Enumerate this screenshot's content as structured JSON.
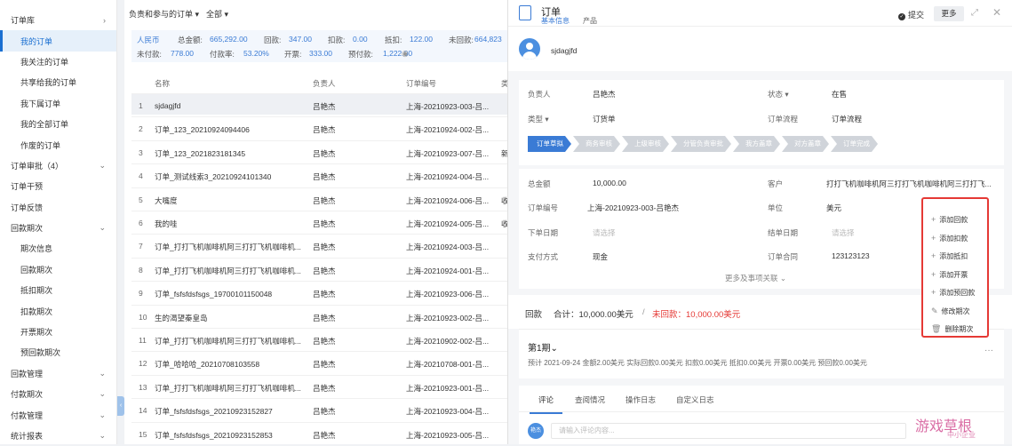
{
  "sidebar": {
    "items": [
      {
        "label": "订单库",
        "chev": "›",
        "child": false,
        "active": false
      },
      {
        "label": "我的订单",
        "chev": "",
        "child": true,
        "active": true
      },
      {
        "label": "我关注的订单",
        "chev": "",
        "child": true,
        "active": false
      },
      {
        "label": "共享给我的订单",
        "chev": "",
        "child": true,
        "active": false
      },
      {
        "label": "我下属订单",
        "chev": "",
        "child": true,
        "active": false
      },
      {
        "label": "我的全部订单",
        "chev": "",
        "child": true,
        "active": false
      },
      {
        "label": "作废的订单",
        "chev": "",
        "child": true,
        "active": false
      },
      {
        "label": "订单审批（4）",
        "chev": "⌄",
        "child": false,
        "active": false
      },
      {
        "label": "订单干预",
        "chev": "",
        "child": false,
        "active": false
      },
      {
        "label": "订单反馈",
        "chev": "",
        "child": false,
        "active": false
      },
      {
        "label": "回款期次",
        "chev": "⌄",
        "child": false,
        "active": false
      },
      {
        "label": "期次信息",
        "chev": "",
        "child": true,
        "active": false
      },
      {
        "label": "回款期次",
        "chev": "",
        "child": true,
        "active": false
      },
      {
        "label": "抵扣期次",
        "chev": "",
        "child": true,
        "active": false
      },
      {
        "label": "扣款期次",
        "chev": "",
        "child": true,
        "active": false
      },
      {
        "label": "开票期次",
        "chev": "",
        "child": true,
        "active": false
      },
      {
        "label": "预回款期次",
        "chev": "",
        "child": true,
        "active": false
      },
      {
        "label": "回款管理",
        "chev": "⌄",
        "child": false,
        "active": false
      },
      {
        "label": "付款期次",
        "chev": "⌄",
        "child": false,
        "active": false
      },
      {
        "label": "付款管理",
        "chev": "⌄",
        "child": false,
        "active": false
      },
      {
        "label": "统计报表",
        "chev": "⌄",
        "child": false,
        "active": false
      }
    ],
    "collapse": "‹"
  },
  "list": {
    "filter": "负责和参与的订单 ▾",
    "scope": "全部 ▾",
    "summary": {
      "currency": "人民币",
      "total_label": "总金额:",
      "total": "665,292.00",
      "back_label": "回款:",
      "back": "347.00",
      "deduct_label": "扣款:",
      "deduct": "0.00",
      "offset_label": "抵扣:",
      "offset": "122.00",
      "unback_label": "未回款:",
      "unback": "664,823",
      "unpaid_label": "未付款:",
      "unpaid": "778.00",
      "payrate_label": "付款率:",
      "payrate": "53.20%",
      "invoice_label": "开票:",
      "invoice": "333.00",
      "prepay_label": "预付款:",
      "prepay": "1,222.00"
    },
    "columns": {
      "name": "名称",
      "owner": "负责人",
      "code": "订单编号",
      "extra": "类"
    },
    "rows": [
      {
        "no": "1",
        "name": "sjdagjfd",
        "owner": "吕艳杰",
        "code": "上海-20210923-003-吕...",
        "extra": ""
      },
      {
        "no": "2",
        "name": "订单_123_20210924094406",
        "owner": "吕艳杰",
        "code": "上海-20210924-002-吕...",
        "extra": ""
      },
      {
        "no": "3",
        "name": "订单_123_2021823181345",
        "owner": "吕艳杰",
        "code": "上海-20210923-007-吕...",
        "extra": "新"
      },
      {
        "no": "4",
        "name": "订单_测试线索3_20210924101340",
        "owner": "吕艳杰",
        "code": "上海-20210924-004-吕...",
        "extra": ""
      },
      {
        "no": "5",
        "name": "大嘴度",
        "owner": "吕艳杰",
        "code": "上海-20210924-006-吕...",
        "extra": "收"
      },
      {
        "no": "6",
        "name": "我的哇",
        "owner": "吕艳杰",
        "code": "上海-20210924-005-吕...",
        "extra": "收"
      },
      {
        "no": "7",
        "name": "订单_打打飞机咖啡机阿三打打飞机咖啡机...",
        "owner": "吕艳杰",
        "code": "上海-20210924-003-吕...",
        "extra": ""
      },
      {
        "no": "8",
        "name": "订单_打打飞机咖啡机阿三打打飞机咖啡机...",
        "owner": "吕艳杰",
        "code": "上海-20210924-001-吕...",
        "extra": ""
      },
      {
        "no": "9",
        "name": "订单_fsfsfdsfsgs_19700101150048",
        "owner": "吕艳杰",
        "code": "上海-20210923-006-吕...",
        "extra": ""
      },
      {
        "no": "10",
        "name": "生的渴望秦皇岛",
        "owner": "吕艳杰",
        "code": "上海-20210923-002-吕...",
        "extra": ""
      },
      {
        "no": "11",
        "name": "订单_打打飞机咖啡机阿三打打飞机咖啡机...",
        "owner": "吕艳杰",
        "code": "上海-20210902-002-吕...",
        "extra": ""
      },
      {
        "no": "12",
        "name": "订单_哈哈哈_20210708103558",
        "owner": "吕艳杰",
        "code": "上海-20210708-001-吕...",
        "extra": ""
      },
      {
        "no": "13",
        "name": "订单_打打飞机咖啡机阿三打打飞机咖啡机...",
        "owner": "吕艳杰",
        "code": "上海-20210923-001-吕...",
        "extra": ""
      },
      {
        "no": "14",
        "name": "订单_fsfsfdsfsgs_20210923152827",
        "owner": "吕艳杰",
        "code": "上海-20210923-004-吕...",
        "extra": ""
      },
      {
        "no": "15",
        "name": "订单_fsfsfdsfsgs_20210923152853",
        "owner": "吕艳杰",
        "code": "上海-20210923-005-吕...",
        "extra": ""
      }
    ]
  },
  "detail": {
    "title": "订单",
    "tab_basic": "基本信息",
    "tab_product": "产品",
    "submit": "提交",
    "more": "更多",
    "expand": "⤢",
    "close": "✕",
    "user": "sjdagjfd",
    "owner_label": "负责人",
    "owner": "吕艳杰",
    "status_label": "状态 ▾",
    "status": "在售",
    "type_label": "类型 ▾",
    "type": "订货单",
    "flow_label": "订单流程",
    "flow": "订单流程",
    "steps": [
      "订单草拟",
      "商务审核",
      "上级审核",
      "分管负责审批",
      "我方盖章",
      "对方盖章",
      "订单完成"
    ],
    "amount_label": "总金额",
    "amount": "10,000.00",
    "customer_label": "客户",
    "customer": "打打飞机咖啡机阿三打打飞机咖啡机阿三打打飞...",
    "code_label": "订单编号",
    "code": "上海-20210923-003-吕艳杰",
    "unit_label": "单位",
    "unit": "美元",
    "date_label": "下单日期",
    "date_ph": "请选择",
    "settle_label": "结单日期",
    "settle_ph": "请选择",
    "pay_label": "支付方式",
    "pay": "现金",
    "contract_label": "订单合同",
    "contract": "123123123",
    "more_fields": "更多及事项关联 ⌄",
    "ret_title": "回款",
    "ret_total": "合计：10,000.00美元",
    "ret_sep": "/",
    "ret_unback": "未回款：10,000.00美元",
    "period_title": "第1期⌄",
    "period_desc": "预计 2021-09-24 金额2.00美元 实际回款0.00美元 扣款0.00美元 抵扣0.00美元 开票0.00美元 预回款0.00美元",
    "period_more": "···",
    "tabs": [
      "评论",
      "查阅情况",
      "操作日志",
      "自定义日志"
    ],
    "comment_avatar": "艳杰",
    "comment_ph": "请输入评论内容..."
  },
  "popup": {
    "items": [
      {
        "icon": "+",
        "label": "添加回款"
      },
      {
        "icon": "+",
        "label": "添加扣款"
      },
      {
        "icon": "+",
        "label": "添加抵扣"
      },
      {
        "icon": "+",
        "label": "添加开票"
      },
      {
        "icon": "+",
        "label": "添加预回款"
      },
      {
        "icon": "✎",
        "label": "修改期次"
      },
      {
        "icon": "🗑",
        "label": "删除期次"
      }
    ]
  },
  "watermark": {
    "big": "游戏草根",
    "small": "中小企业"
  },
  "colors": {
    "accent": "#3a7bd5",
    "warn": "#e53935"
  }
}
